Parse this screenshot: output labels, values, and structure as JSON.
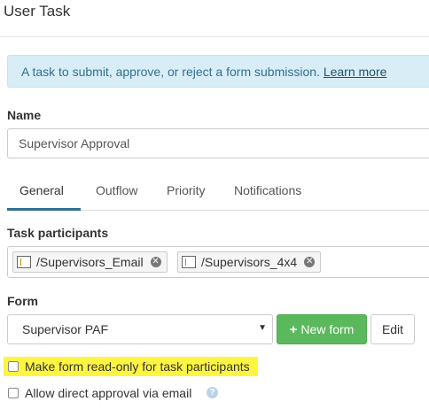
{
  "header": {
    "title": "User Task"
  },
  "info": {
    "text": "A task to submit, approve, or reject a form submission.",
    "link": "Learn more"
  },
  "name_field": {
    "label": "Name",
    "value": "Supervisor Approval"
  },
  "tabs": [
    {
      "label": "General",
      "active": true
    },
    {
      "label": "Outflow",
      "active": false
    },
    {
      "label": "Priority",
      "active": false
    },
    {
      "label": "Notifications",
      "active": false
    }
  ],
  "participants": {
    "label": "Task participants",
    "chips": [
      {
        "label": "/Supervisors_Email",
        "icon": "text-field-icon"
      },
      {
        "label": "/Supervisors_4x4",
        "icon": "text-field-icon"
      }
    ]
  },
  "form": {
    "label": "Form",
    "selected": "Supervisor PAF",
    "new_button": "New form",
    "edit_button": "Edit"
  },
  "options": {
    "readonly_label": "Make form read-only for task participants",
    "readonly_checked": false,
    "direct_approval_label": "Allow direct approval via email",
    "direct_approval_checked": false
  },
  "colors": {
    "info_bg": "#d9edf7",
    "link": "#245269",
    "tab_active": "#2f6f8f",
    "primary_green": "#5cb85c",
    "highlight": "#fdf542"
  }
}
